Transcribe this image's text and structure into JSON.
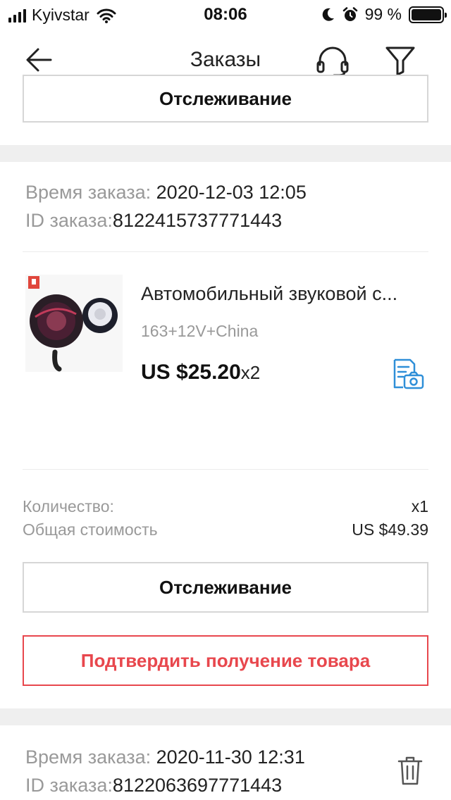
{
  "status_bar": {
    "carrier": "Kyivstar",
    "time": "08:06",
    "battery_text": "99 %",
    "battery_level": 0.99
  },
  "nav": {
    "title": "Заказы"
  },
  "top_order": {
    "tracking_label": "Отслеживание"
  },
  "order": {
    "time_label": "Время заказа:",
    "time_value": "2020-12-03 12:05",
    "id_label": "ID заказа:",
    "id_value": "8122415737771443",
    "product": {
      "title": "Автомобильный звуковой с...",
      "variant": "163+12V+China",
      "price": "US $25.20",
      "qty": "x2"
    },
    "quantity_label": "Количество:",
    "quantity_value": "x1",
    "total_label": "Общая стоимость",
    "total_value": "US $49.39",
    "tracking_label": "Отслеживание",
    "confirm_label": "Подтвердить получение товара"
  },
  "next_order": {
    "time_label": "Время заказа:",
    "time_value": "2020-11-30 12:31",
    "id_label": "ID заказа:",
    "id_value": "8122063697771443"
  },
  "colors": {
    "accent_red": "#e8474d",
    "muted_text": "#999999",
    "snapshot_blue": "#2f8fd8"
  },
  "icons": {
    "back": "arrow-left-icon",
    "support": "headset-icon",
    "filter": "funnel-icon",
    "snapshot": "document-camera-icon",
    "delete": "trash-icon"
  }
}
